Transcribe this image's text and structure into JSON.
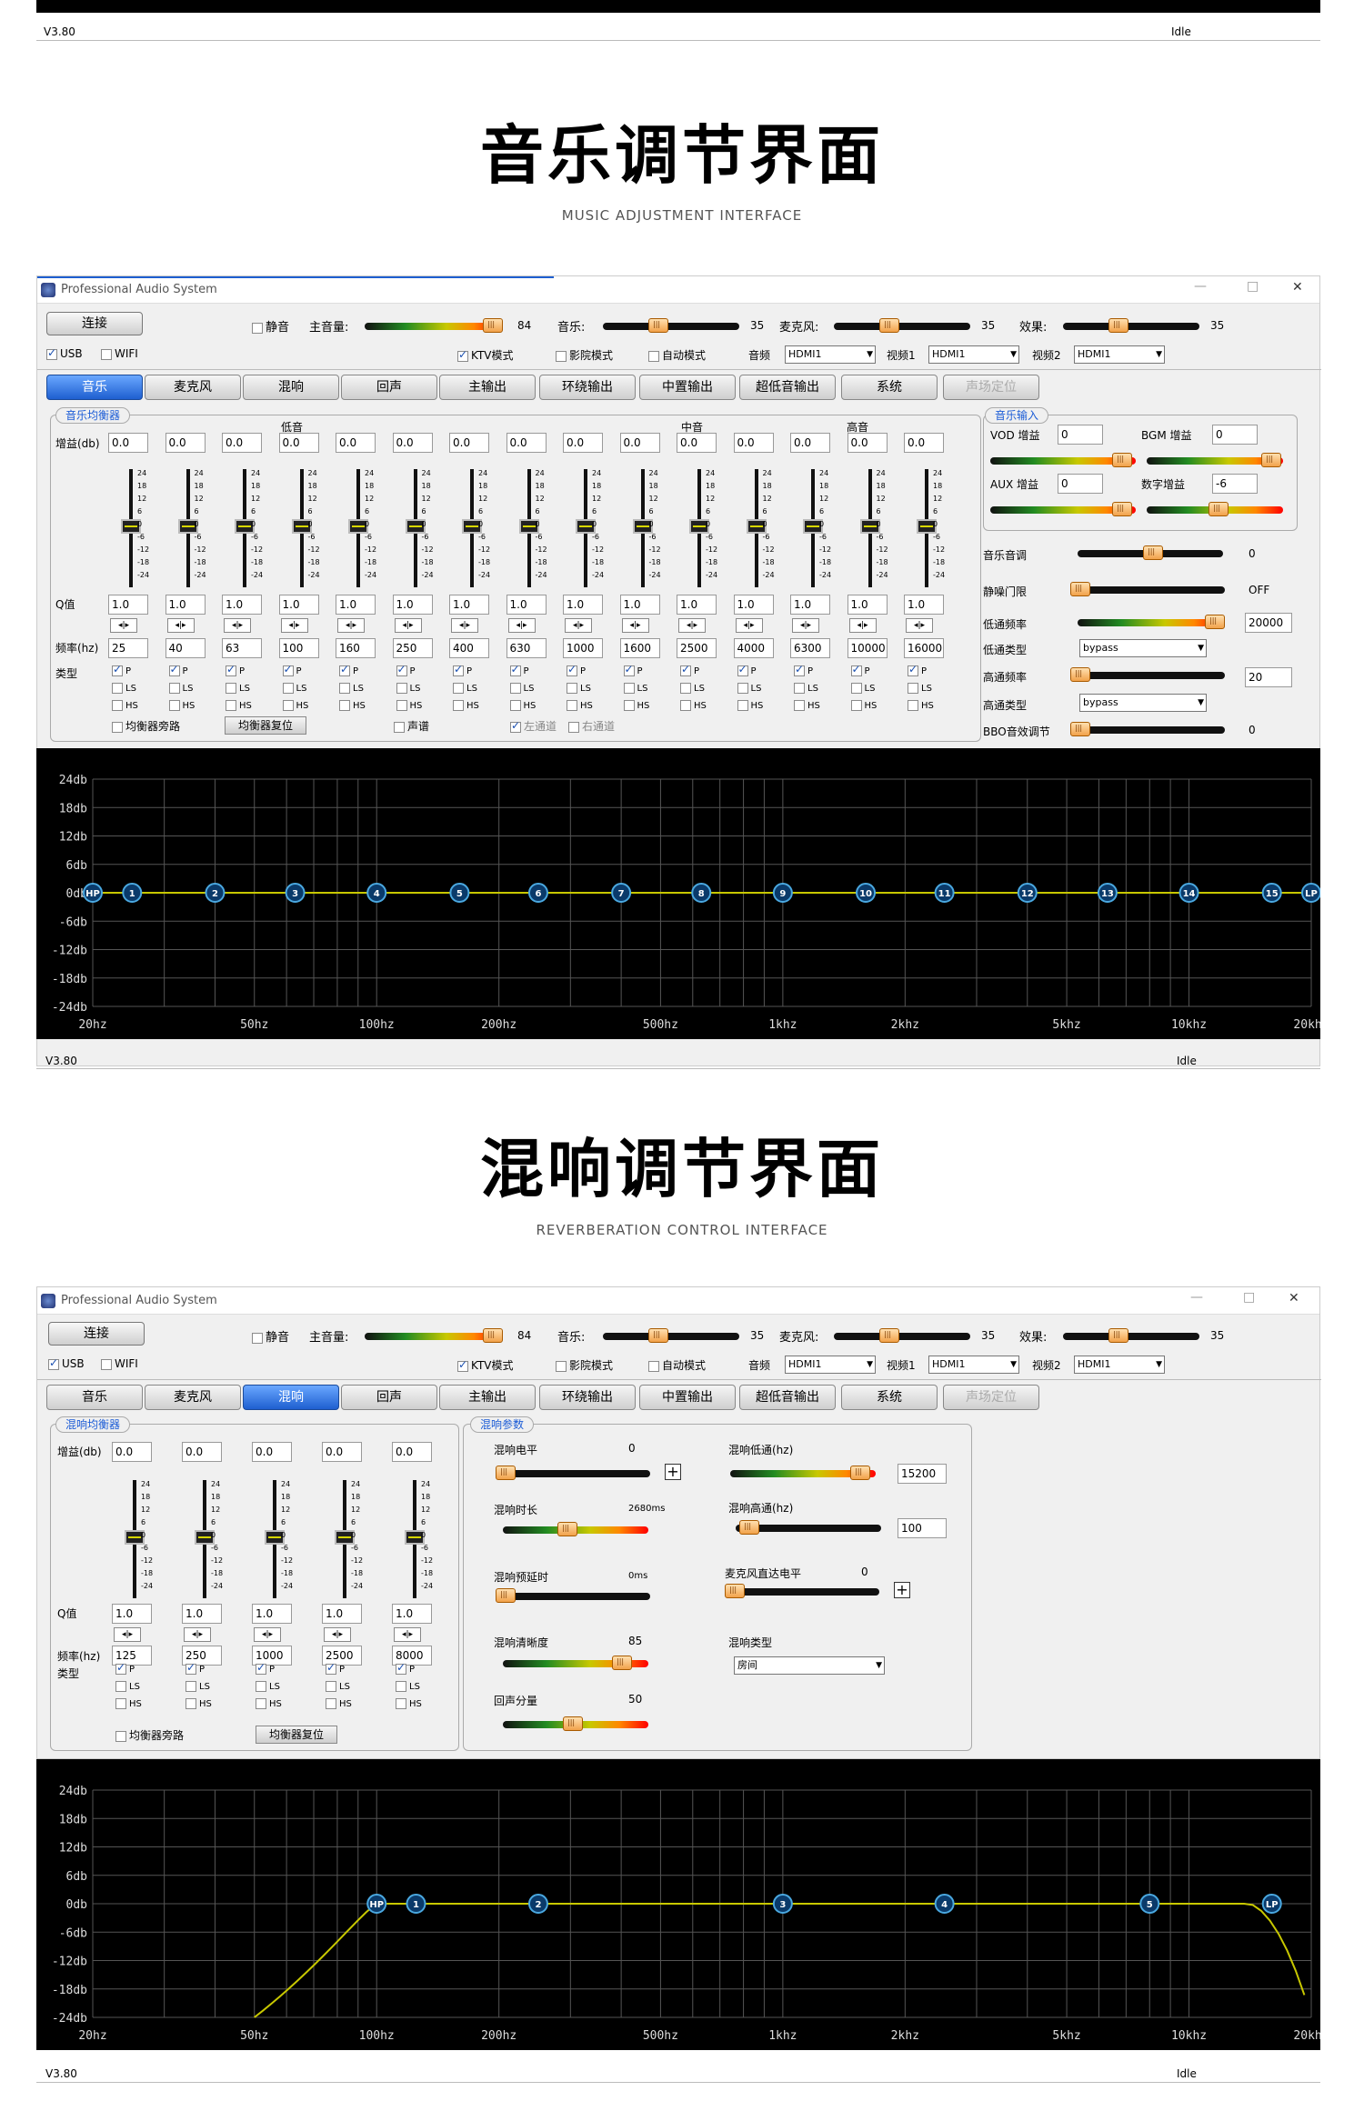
{
  "top_strip": {
    "version": "V3.80",
    "status": "Idle"
  },
  "section1": {
    "title": "音乐调节界面",
    "subtitle": "MUSIC ADJUSTMENT INTERFACE"
  },
  "section2": {
    "title": "混响调节界面",
    "subtitle": "REVERBERATION CONTROL INTERFACE"
  },
  "app": {
    "title": "Professional Audio System",
    "connect": "连接",
    "mute": "静音",
    "master_label": "主音量:",
    "master_value": "84",
    "music_label": "音乐:",
    "music_value": "35",
    "mic_label": "麦克风:",
    "mic_value": "35",
    "effect_label": "效果:",
    "effect_value": "35",
    "usb": "USB",
    "wifi": "WIFI",
    "ktv": "KTV模式",
    "cinema": "影院模式",
    "auto": "自动模式",
    "audio_label": "音频",
    "audio_value": "HDMI1",
    "video1_label": "视频1",
    "video1_value": "HDMI1",
    "video2_label": "视频2",
    "video2_value": "HDMI1",
    "min_icon": "—",
    "max_icon": "□",
    "close_icon": "✕"
  },
  "tabs": [
    "音乐",
    "麦克风",
    "混响",
    "回声",
    "主输出",
    "环绕输出",
    "中置输出",
    "超低音输出",
    "系统",
    "声场定位"
  ],
  "music_eq": {
    "legend": "音乐均衡器",
    "gain_label": "增益(db)",
    "q_label": "Q值",
    "freq_label": "频率(hz)",
    "type_label": "类型",
    "bass": "低音",
    "mid": "中音",
    "treble": "高音",
    "gains": [
      "0.0",
      "0.0",
      "0.0",
      "0.0",
      "0.0",
      "0.0",
      "0.0",
      "0.0",
      "0.0",
      "0.0",
      "0.0",
      "0.0",
      "0.0",
      "0.0",
      "0.0"
    ],
    "q": [
      "1.0",
      "1.0",
      "1.0",
      "1.0",
      "1.0",
      "1.0",
      "1.0",
      "1.0",
      "1.0",
      "1.0",
      "1.0",
      "1.0",
      "1.0",
      "1.0",
      "1.0"
    ],
    "freqs": [
      "25",
      "40",
      "63",
      "100",
      "160",
      "250",
      "400",
      "630",
      "1000",
      "1600",
      "2500",
      "4000",
      "6300",
      "10000",
      "16000"
    ],
    "ticks": [
      "24",
      "18",
      "12",
      "6",
      "0",
      "-6",
      "-12",
      "-18",
      "-24"
    ],
    "type_p": "P",
    "type_ls": "LS",
    "type_hs": "HS",
    "bypass": "均衡器旁路",
    "reset": "均衡器复位",
    "stereo": "声谱",
    "left": "左通道",
    "right": "右通道",
    "spin": "◂|▸"
  },
  "music_input": {
    "legend": "音乐输入",
    "vod_label": "VOD 增益",
    "vod_value": "0",
    "bgm_label": "BGM 增益",
    "bgm_value": "0",
    "aux_label": "AUX 增益",
    "aux_value": "0",
    "digital_label": "数字增益",
    "digital_value": "-6",
    "pitch_label": "音乐音调",
    "pitch_value": "0",
    "noise_label": "静噪门限",
    "noise_value": "OFF",
    "lpf_label": "低通频率",
    "lpf_value": "20000",
    "lpf_type_label": "低通类型",
    "lpf_type_value": "bypass",
    "hpf_label": "高通频率",
    "hpf_value": "20",
    "hpf_type_label": "高通类型",
    "hpf_type_value": "bypass",
    "bbo_label": "BBO音效调节",
    "bbo_value": "0"
  },
  "graph": {
    "db_labels": [
      "24db",
      "18db",
      "12db",
      "6db",
      "0db",
      "-6db",
      "-12db",
      "-18db",
      "-24db"
    ],
    "hz_labels": [
      "20hz",
      "50hz",
      "100hz",
      "200hz",
      "500hz",
      "1khz",
      "2khz",
      "5khz",
      "10khz",
      "20khz"
    ],
    "eq_points": [
      "HP",
      "1",
      "2",
      "3",
      "4",
      "5",
      "6",
      "7",
      "8",
      "9",
      "10",
      "11",
      "12",
      "13",
      "14",
      "15",
      "LP"
    ],
    "reverb_points": [
      "HP",
      "1",
      "2",
      "3",
      "4",
      "5",
      "LP"
    ]
  },
  "status1": {
    "version": "V3.80",
    "status": "Idle"
  },
  "status2": {
    "version": "V3.80",
    "status": "Idle"
  },
  "reverb_eq": {
    "legend": "混响均衡器",
    "gains": [
      "0.0",
      "0.0",
      "0.0",
      "0.0",
      "0.0"
    ],
    "q": [
      "1.0",
      "1.0",
      "1.0",
      "1.0",
      "1.0"
    ],
    "freqs": [
      "125",
      "250",
      "1000",
      "2500",
      "8000"
    ]
  },
  "reverb_params": {
    "legend": "混响参数",
    "level_label": "混响电平",
    "level_value": "0",
    "time_label": "混响时长",
    "time_value": "2680ms",
    "predelay_label": "混响预延时",
    "predelay_value": "0ms",
    "clarity_label": "混响清晰度",
    "clarity_value": "85",
    "echo_label": "回声分量",
    "echo_value": "50",
    "lowpass_label": "混响低通(hz)",
    "lowpass_value": "15200",
    "highpass_label": "混响高通(hz)",
    "highpass_value": "100",
    "direct_label": "麦克风直达电平",
    "direct_value": "0",
    "type_label": "混响类型",
    "type_value": "房间",
    "plus": "+"
  },
  "colors": {
    "accent": "#1a5bd6",
    "graph_bg": "#000000",
    "curve": "#c8c800",
    "point": "#2a7fb0"
  }
}
